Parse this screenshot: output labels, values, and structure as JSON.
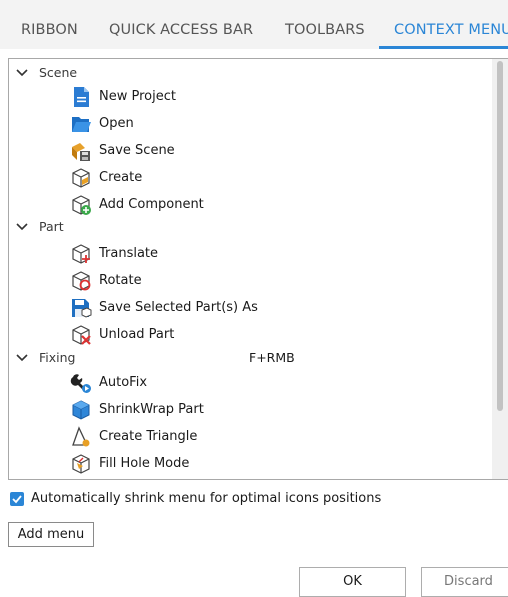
{
  "tabs": [
    {
      "label": "RIBBON"
    },
    {
      "label": "QUICK ACCESS BAR"
    },
    {
      "label": "TOOLBARS"
    },
    {
      "label": "CONTEXT MENU",
      "active": true
    }
  ],
  "tree": {
    "groups": [
      {
        "label": "Scene",
        "expanded": true,
        "items": [
          {
            "label": "New Project",
            "icon": "new-project-document-icon"
          },
          {
            "label": "Open",
            "icon": "open-folder-icon"
          },
          {
            "label": "Save Scene",
            "icon": "save-scene-icon"
          },
          {
            "label": "Create",
            "icon": "create-cube-icon"
          },
          {
            "label": "Add Component",
            "icon": "add-component-cube-icon"
          }
        ]
      },
      {
        "label": "Part",
        "expanded": true,
        "items": [
          {
            "label": "Translate",
            "icon": "translate-cube-icon"
          },
          {
            "label": "Rotate",
            "icon": "rotate-cube-icon"
          },
          {
            "label": "Save Selected Part(s) As",
            "icon": "save-part-floppy-icon"
          },
          {
            "label": "Unload Part",
            "icon": "unload-part-cube-icon"
          }
        ]
      },
      {
        "label": "Fixing",
        "expanded": true,
        "shortcut": "F+RMB",
        "items": [
          {
            "label": "AutoFix",
            "icon": "autofix-wrench-icon"
          },
          {
            "label": "ShrinkWrap Part",
            "icon": "shrinkwrap-cube-icon"
          },
          {
            "label": "Create Triangle",
            "icon": "create-triangle-icon"
          },
          {
            "label": "Fill Hole Mode",
            "icon": "fill-hole-cube-icon"
          }
        ]
      }
    ]
  },
  "options": {
    "shrink_menu_label": "Automatically shrink menu for optimal icons positions",
    "shrink_menu_checked": true
  },
  "buttons": {
    "add_menu": "Add menu",
    "ok": "OK",
    "discard": "Discard"
  },
  "colors": {
    "accent": "#2b86d6",
    "tab_bar_bg": "#f3f3f3",
    "tab_inactive": "#555555"
  }
}
